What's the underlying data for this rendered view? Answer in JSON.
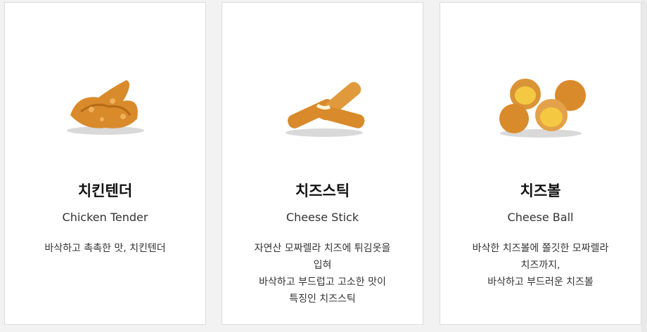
{
  "menu_items": [
    {
      "name_ko": "치킨텐더",
      "name_en": "Chicken Tender",
      "description_lines": [
        "바삭하고 촉촉한 맛, 치킨텐더"
      ],
      "image_icon": "chicken-tender-image"
    },
    {
      "name_ko": "치즈스틱",
      "name_en": "Cheese Stick",
      "description_lines": [
        "자연산 모짜렐라 치즈에 튀김옷을",
        "입혀",
        "바삭하고 부드럽고 고소한 맛이",
        "특징인 치즈스틱"
      ],
      "image_icon": "cheese-stick-image"
    },
    {
      "name_ko": "치즈볼",
      "name_en": "Cheese Ball",
      "description_lines": [
        "바삭한 치즈볼에 쫄깃한 모짜렐라",
        "치즈까지,",
        "바삭하고 부드러운 치즈볼"
      ],
      "image_icon": "cheese-ball-image"
    }
  ],
  "colors": {
    "card_bg": "#ffffff",
    "page_bg": "#f2f2f2",
    "fried_golden": "#d98a2b",
    "cheese_yellow": "#f5c842"
  }
}
